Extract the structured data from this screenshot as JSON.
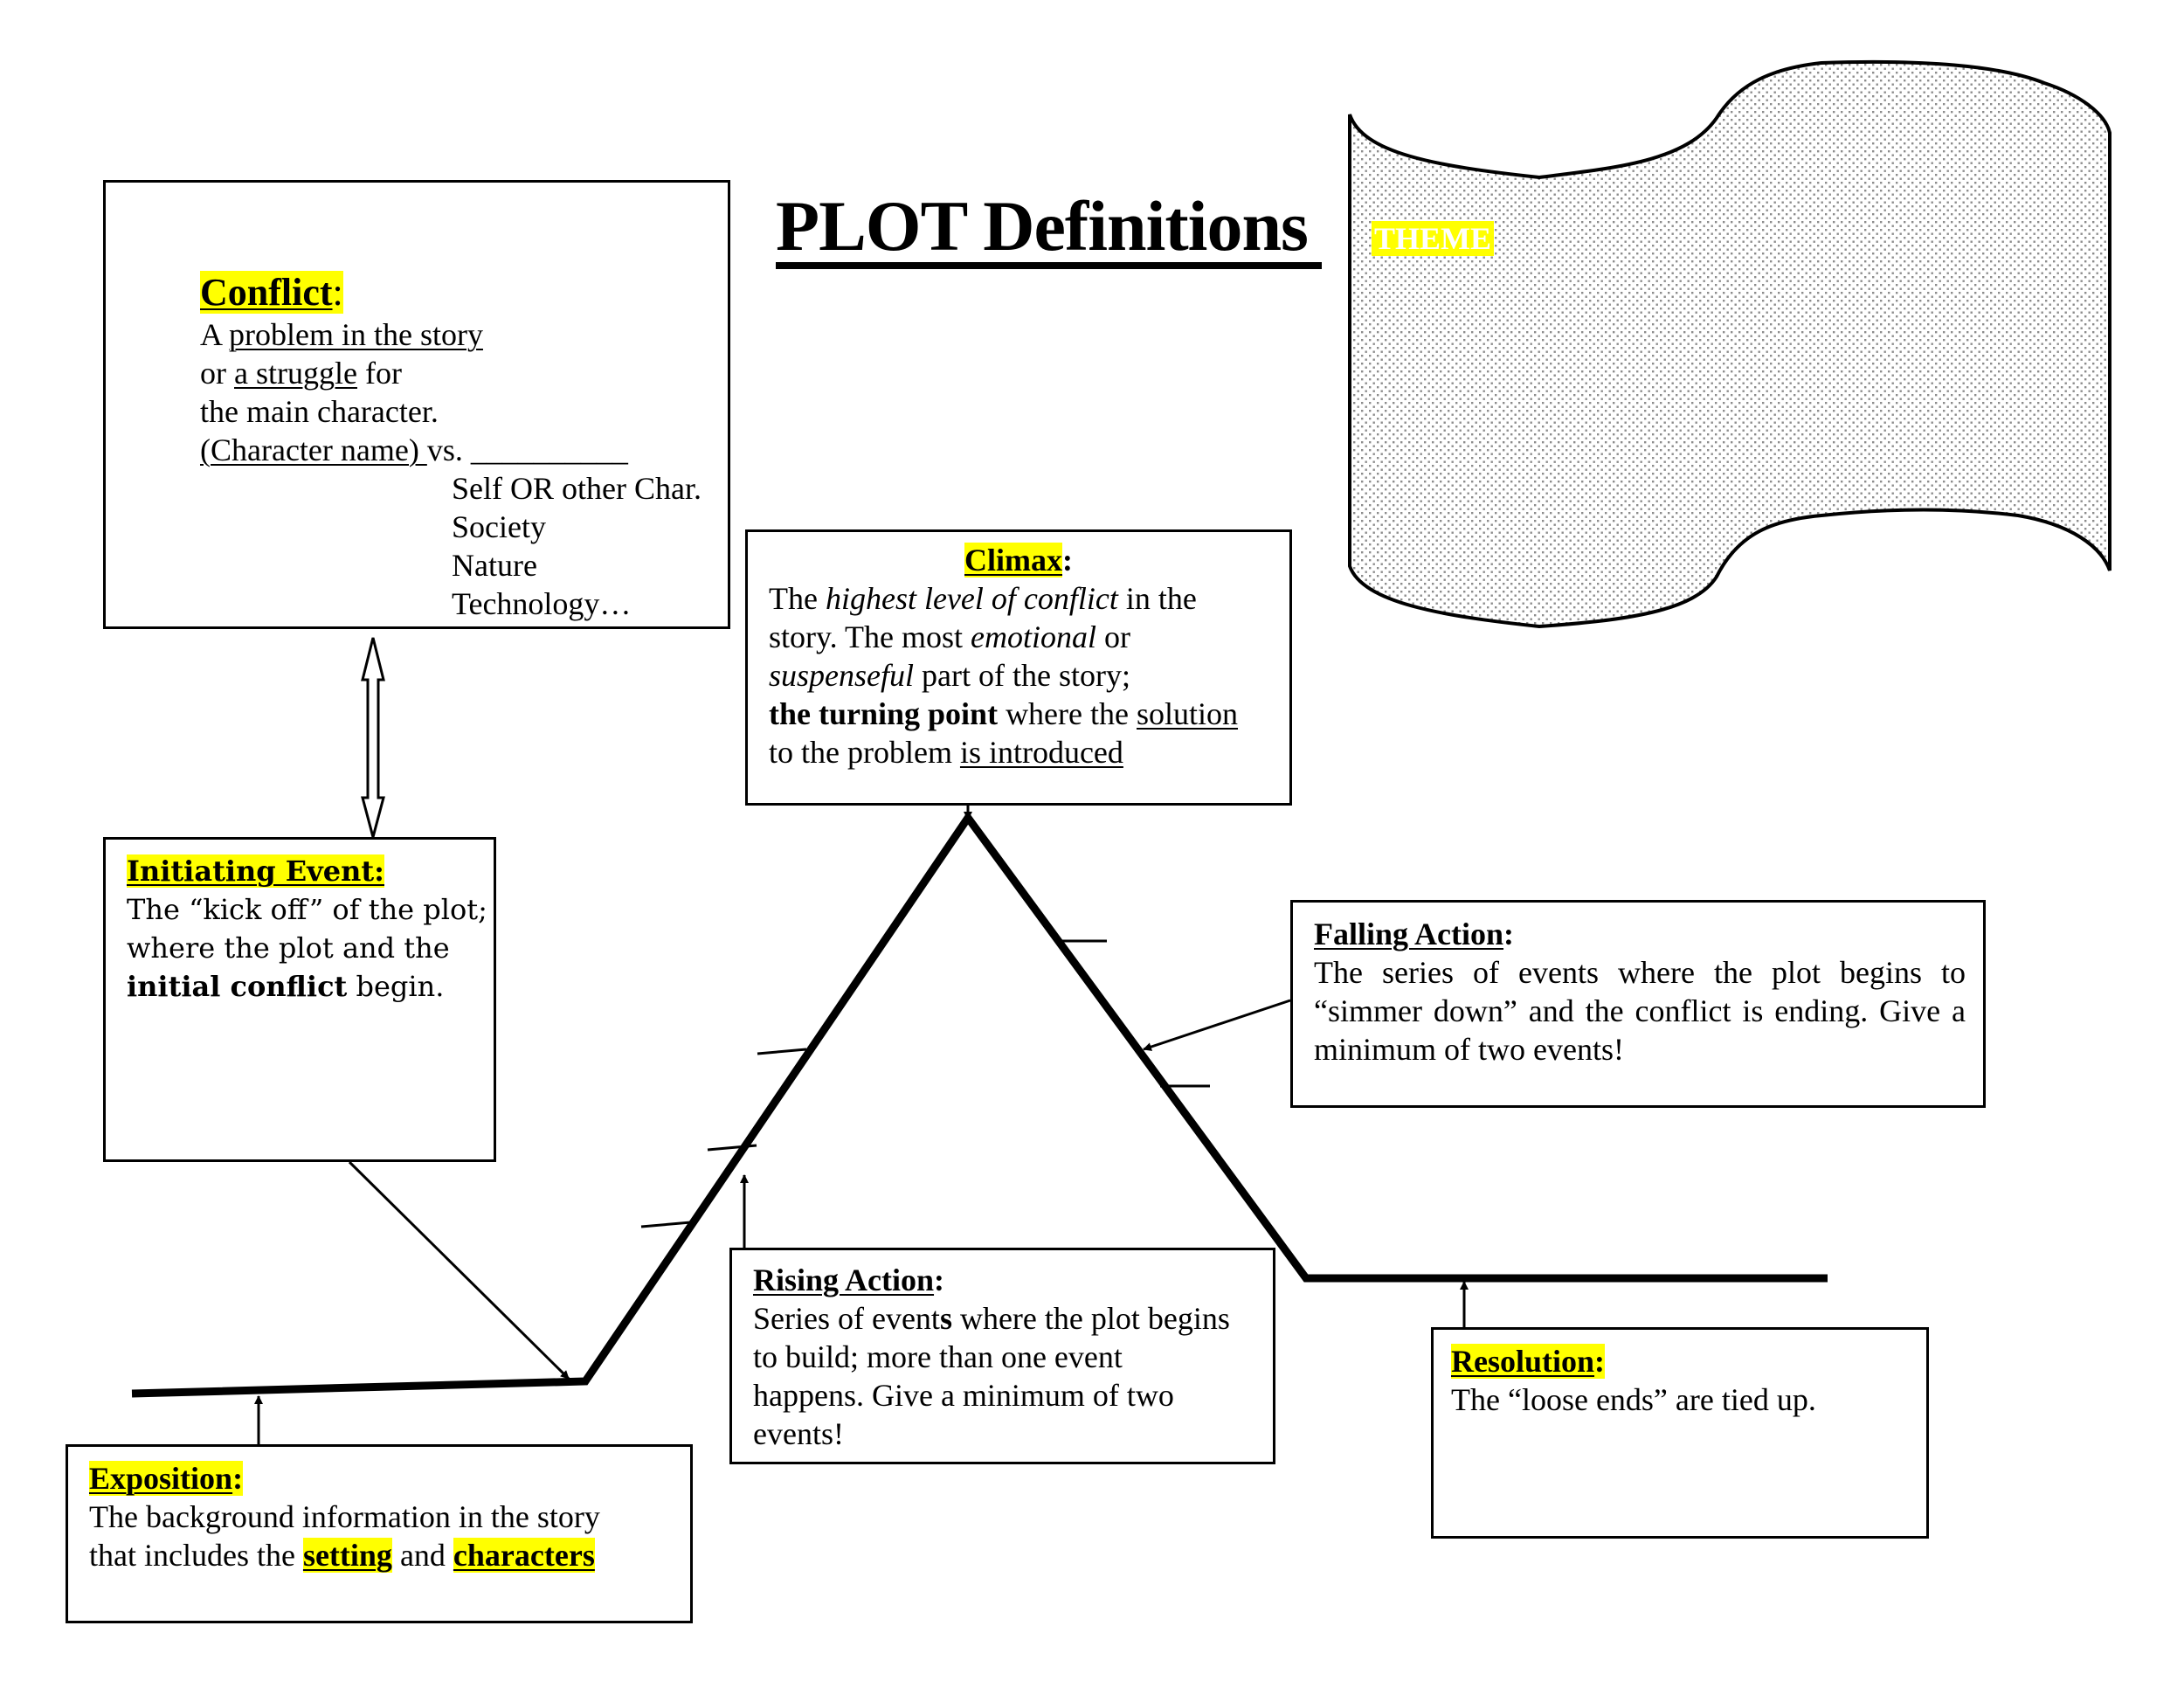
{
  "page": {
    "title": "PLOT Definitions"
  },
  "theme": {
    "label": "THEME",
    "fill_pattern": "stippled-dots",
    "label_highlight": "#ffff00",
    "label_text_color": "#ffffff"
  },
  "colors": {
    "highlight": "#ffff00",
    "ink": "#000000",
    "stipple": "#8c8c8c"
  },
  "conflict": {
    "heading": "Conflict",
    "heading_suffix": ":",
    "line1_prefix": "A ",
    "line1_underlined": "problem in the story",
    "line2_prefix": "or ",
    "line2_underlined": "a struggle",
    "line2_suffix": " for",
    "line3": "the main character.",
    "line4_underlined": "(Character name) ",
    "line4_suffix": "vs. ",
    "blank": "__________",
    "options": [
      "Self  OR other Char.",
      "Society",
      "Nature",
      "Technology…"
    ]
  },
  "climax": {
    "heading": "Climax",
    "heading_suffix": ":",
    "l1_a": "The ",
    "l1_b": "highest level of conflict",
    "l1_c": " in the",
    "l2_a": "story. The most ",
    "l2_b": "emotional",
    "l2_c": " or",
    "l3_a": "suspenseful",
    "l3_b": " part of the story;",
    "l4_a": "the turning point",
    "l4_b": " where the ",
    "l4_c": "solution",
    "l5_a": "to the problem ",
    "l5_b": "is introduced"
  },
  "initiating_event": {
    "heading": "Initiating Event:",
    "l1": "The “kick off” of the plot;",
    "l2": "where the plot and the",
    "l3_bold": "initial conflict",
    "l3_rest": " begin."
  },
  "falling_action": {
    "heading": "Falling Action",
    "heading_suffix": ":",
    "body": "The series of events where the plot begins to “simmer down” and the conflict is ending. Give a minimum of two events!"
  },
  "rising_action": {
    "heading": "Rising Action",
    "heading_suffix": ":",
    "l1_a": "Series of event",
    "l1_b": "s",
    "l1_c": " where the plot begins",
    "l2": "to build; more than one event",
    "l3": "happens. Give a minimum of two",
    "l4": "events!"
  },
  "resolution": {
    "heading": "Resolution",
    "heading_suffix": ":",
    "body": "The “loose ends” are tied up."
  },
  "exposition": {
    "heading": "Exposition",
    "heading_suffix": ":",
    "l1": "The background information in the story",
    "l2_a": "that includes the ",
    "l2_setting": "setting",
    "l2_b": " and ",
    "l2_characters": "characters"
  },
  "plot_diagram": {
    "stages": [
      "Exposition",
      "Initiating Event",
      "Rising Action",
      "Climax",
      "Falling Action",
      "Resolution"
    ],
    "rising_action_blank_ticks": 3,
    "falling_action_blank_ticks": 2
  }
}
